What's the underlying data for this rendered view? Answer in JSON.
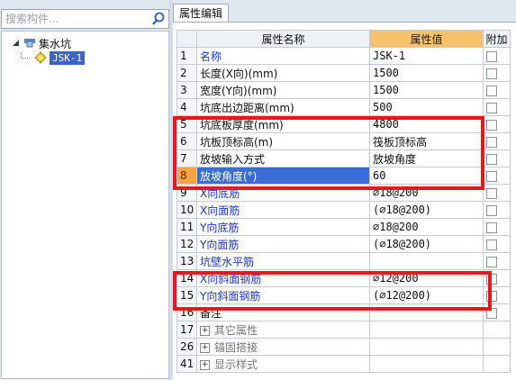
{
  "search": {
    "placeholder": "搜索构件..."
  },
  "tree": {
    "root_label": "集水坑",
    "child_label": "JSK-1"
  },
  "tab": {
    "label": "属性编辑"
  },
  "table": {
    "headers": {
      "name": "属性名称",
      "value": "属性值",
      "extra": "附加"
    },
    "rows": [
      {
        "idx": "1",
        "name": "名称",
        "value": "JSK-1"
      },
      {
        "idx": "2",
        "name": "长度(X向)(mm)",
        "value": "1500"
      },
      {
        "idx": "3",
        "name": "宽度(Y向)(mm)",
        "value": "1500"
      },
      {
        "idx": "4",
        "name": "坑底出边距离(mm)",
        "value": "500"
      },
      {
        "idx": "5",
        "name": "坑底板厚度(mm)",
        "value": "4800"
      },
      {
        "idx": "6",
        "name": "坑板顶标高(m)",
        "value": "筏板顶标高"
      },
      {
        "idx": "7",
        "name": "放坡输入方式",
        "value": "放坡角度"
      },
      {
        "idx": "8",
        "name": "放坡角度(°)",
        "value": "60"
      },
      {
        "idx": "9",
        "name": "X向底筋",
        "value": "⌀18@200"
      },
      {
        "idx": "10",
        "name": "X向面筋",
        "value": "(⌀18@200)"
      },
      {
        "idx": "11",
        "name": "Y向底筋",
        "value": "⌀18@200"
      },
      {
        "idx": "12",
        "name": "Y向面筋",
        "value": "(⌀18@200)"
      },
      {
        "idx": "13",
        "name": "坑壁水平筋",
        "value": ""
      },
      {
        "idx": "14",
        "name": "X向斜面钢筋",
        "value": "⌀12@200"
      },
      {
        "idx": "15",
        "name": "Y向斜面钢筋",
        "value": "(⌀12@200)"
      },
      {
        "idx": "16",
        "name": "备注",
        "value": ""
      },
      {
        "idx": "17",
        "name": "其它属性",
        "value": ""
      },
      {
        "idx": "26",
        "name": "锚固搭接",
        "value": ""
      },
      {
        "idx": "41",
        "name": "显示样式",
        "value": ""
      }
    ]
  }
}
